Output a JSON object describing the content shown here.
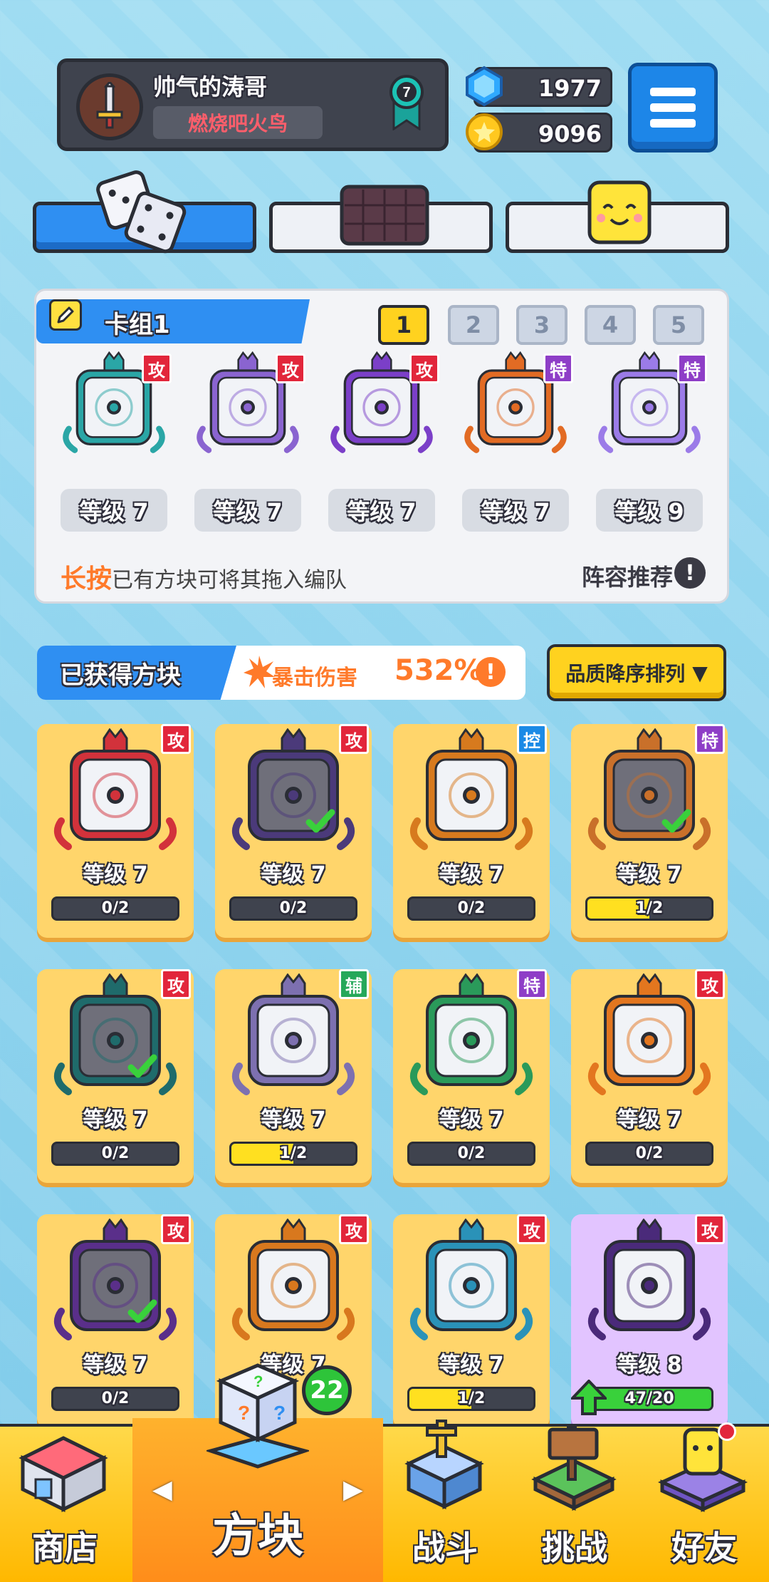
{
  "player": {
    "name": "帅气的涛哥",
    "title": "燃烧吧火鸟",
    "rank": "7"
  },
  "currency": {
    "gems": "1977",
    "coins": "9096"
  },
  "icons": {
    "menu": "menu-icon",
    "gem": "gem-icon",
    "coin": "coin-icon",
    "avatar": "sword-icon",
    "rank": "rank-ribbon-icon"
  },
  "top_tabs": [
    {
      "name": "dice",
      "icon": "dice-icon"
    },
    {
      "name": "board",
      "icon": "board-icon"
    },
    {
      "name": "emote",
      "icon": "smile-block-icon"
    }
  ],
  "deck": {
    "title": "卡组1",
    "numbers": [
      "1",
      "2",
      "3",
      "4",
      "5"
    ],
    "cards": [
      {
        "tag": "攻",
        "level": "等级 7",
        "color": "#2aa6a6"
      },
      {
        "tag": "攻",
        "level": "等级 7",
        "color": "#8a64d0"
      },
      {
        "tag": "攻",
        "level": "等级 7",
        "color": "#7b3fc8"
      },
      {
        "tag": "特",
        "level": "等级 7",
        "color": "#e26b24"
      },
      {
        "tag": "特",
        "level": "等级 9",
        "color": "#9b7be8"
      }
    ],
    "hint_bold": "长按",
    "hint_text": "已有方块可将其拖入编队",
    "recommend": "阵容推荐",
    "recommend_icon": "!"
  },
  "owned": {
    "title": "已获得方块",
    "crit_label": "暴击伤害",
    "crit_value": "532%",
    "crit_info": "!",
    "sort_label": "品质降序排列",
    "sort_arrow": "▼",
    "cards": [
      {
        "tag": "攻",
        "level": "等级 7",
        "progress": "0/2",
        "fill": 0,
        "color": "#d2323b",
        "check": false,
        "dim": false
      },
      {
        "tag": "攻",
        "level": "等级 7",
        "progress": "0/2",
        "fill": 0,
        "color": "#4b3a7a",
        "check": true,
        "dim": true
      },
      {
        "tag": "控",
        "level": "等级 7",
        "progress": "0/2",
        "fill": 0,
        "color": "#d77a1e",
        "check": false,
        "dim": false
      },
      {
        "tag": "特",
        "level": "等级 7",
        "progress": "1/2",
        "fill": 0.5,
        "color": "#c9702a",
        "check": true,
        "dim": true
      },
      {
        "tag": "攻",
        "level": "等级 7",
        "progress": "0/2",
        "fill": 0,
        "color": "#1f6b6b",
        "check": true,
        "dim": true
      },
      {
        "tag": "辅",
        "level": "等级 7",
        "progress": "1/2",
        "fill": 0.5,
        "color": "#7d70b0",
        "check": false,
        "dim": false
      },
      {
        "tag": "特",
        "level": "等级 7",
        "progress": "0/2",
        "fill": 0,
        "color": "#2a9a5a",
        "check": false,
        "dim": false
      },
      {
        "tag": "攻",
        "level": "等级 7",
        "progress": "0/2",
        "fill": 0,
        "color": "#e3761f",
        "check": false,
        "dim": false
      },
      {
        "tag": "攻",
        "level": "等级 7",
        "progress": "0/2",
        "fill": 0,
        "color": "#5a2f8a",
        "check": true,
        "dim": true
      },
      {
        "tag": "攻",
        "level": "等级 7",
        "progress": "",
        "fill": 0,
        "color": "#d8781e",
        "check": false,
        "dim": false
      },
      {
        "tag": "攻",
        "level": "等级 7",
        "progress": "1/2",
        "fill": 0.5,
        "color": "#2a92b8",
        "check": false,
        "dim": false
      },
      {
        "tag": "攻",
        "level": "等级 8",
        "progress": "47/20",
        "fill": 1,
        "color": "#4a2a7a",
        "check": false,
        "dim": false,
        "upgrade": true
      }
    ]
  },
  "nav": {
    "shop": "商店",
    "blocks": "方块",
    "blocks_badge": "22",
    "battle": "战斗",
    "challenge": "挑战",
    "friends": "好友",
    "arrow_left": "◀",
    "arrow_right": "▶"
  }
}
